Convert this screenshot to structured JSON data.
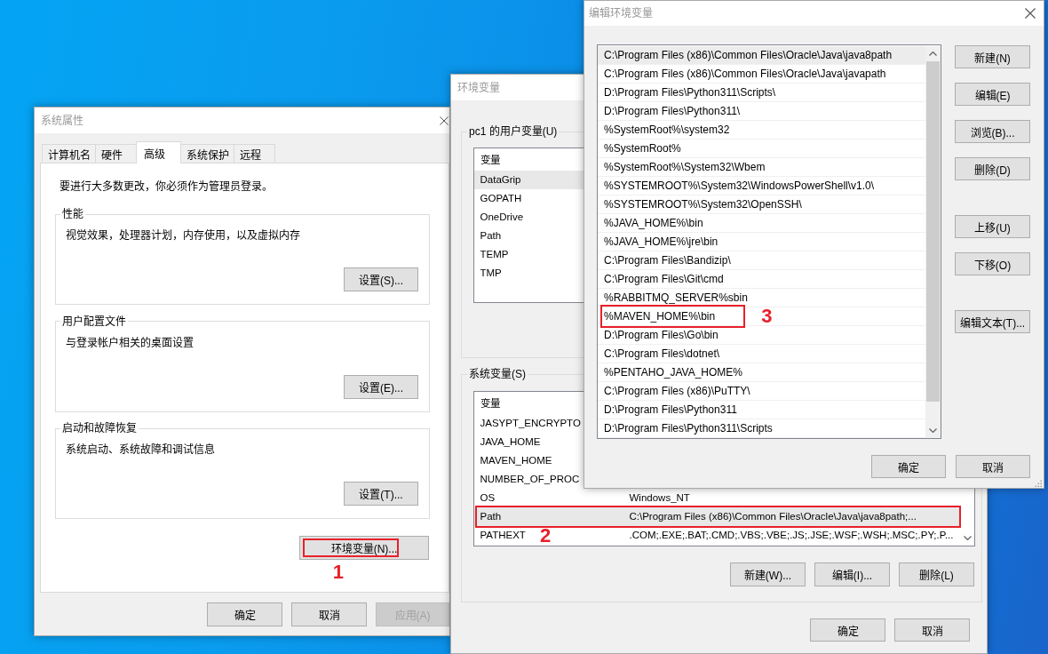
{
  "system_properties": {
    "title": "系统属性",
    "tabs": [
      {
        "label": "计算机名",
        "selected": false
      },
      {
        "label": "硬件",
        "selected": false
      },
      {
        "label": "高级",
        "selected": true
      },
      {
        "label": "系统保护",
        "selected": false
      },
      {
        "label": "远程",
        "selected": false
      }
    ],
    "notice": "要进行大多数更改，你必须作为管理员登录。",
    "groups": [
      {
        "title": "性能",
        "description": "视觉效果，处理器计划，内存使用，以及虚拟内存",
        "button": "设置(S)..."
      },
      {
        "title": "用户配置文件",
        "description": "与登录帐户相关的桌面设置",
        "button": "设置(E)..."
      },
      {
        "title": "启动和故障恢复",
        "description": "系统启动、系统故障和调试信息",
        "button": "设置(T)..."
      }
    ],
    "env_button": {
      "label": "环境变量(N)...",
      "callout": "1"
    },
    "buttons": [
      {
        "label": "确定",
        "disabled": false
      },
      {
        "label": "取消",
        "disabled": false
      },
      {
        "label": "应用(A)",
        "disabled": true
      }
    ]
  },
  "environment_variables": {
    "title": "环境变量",
    "user_variables": {
      "title": "pc1 的用户变量(U)",
      "column_header": "变量",
      "rows": [
        {
          "name": "DataGrip",
          "selected": true
        },
        {
          "name": "GOPATH",
          "selected": false
        },
        {
          "name": "OneDrive",
          "selected": false
        },
        {
          "name": "Path",
          "selected": false
        },
        {
          "name": "TEMP",
          "selected": false
        },
        {
          "name": "TMP",
          "selected": false
        }
      ]
    },
    "system_variables": {
      "title": "系统变量(S)",
      "column_header": "变量",
      "rows": [
        {
          "name": "JASYPT_ENCRYPTO",
          "selected": false
        },
        {
          "name": "JAVA_HOME",
          "selected": false
        },
        {
          "name": "MAVEN_HOME",
          "selected": false
        },
        {
          "name": "NUMBER_OF_PROC",
          "selected": false
        },
        {
          "name": "OS",
          "value": "Windows_NT",
          "selected": false
        },
        {
          "name": "Path",
          "value": "C:\\Program Files (x86)\\Common Files\\Oracle\\Java\\java8path;...",
          "selected": true,
          "callout": "2"
        },
        {
          "name": "PATHEXT",
          "value": ".COM;.EXE;.BAT;.CMD;.VBS;.VBE;.JS;.JSE;.WSF;.WSH;.MSC;.PY;.P...",
          "selected": false
        }
      ],
      "buttons": [
        "新建(W)...",
        "编辑(I)...",
        "删除(L)"
      ]
    },
    "buttons": [
      "确定",
      "取消"
    ]
  },
  "edit_variable": {
    "title": "编辑环境变量",
    "entries": [
      {
        "text": "C:\\Program Files (x86)\\Common Files\\Oracle\\Java\\java8path",
        "selected": true
      },
      {
        "text": "C:\\Program Files (x86)\\Common Files\\Oracle\\Java\\javapath",
        "selected": false
      },
      {
        "text": "D:\\Program Files\\Python311\\Scripts\\",
        "selected": false
      },
      {
        "text": "D:\\Program Files\\Python311\\",
        "selected": false
      },
      {
        "text": "%SystemRoot%\\system32",
        "selected": false
      },
      {
        "text": "%SystemRoot%",
        "selected": false
      },
      {
        "text": "%SystemRoot%\\System32\\Wbem",
        "selected": false
      },
      {
        "text": "%SYSTEMROOT%\\System32\\WindowsPowerShell\\v1.0\\",
        "selected": false
      },
      {
        "text": "%SYSTEMROOT%\\System32\\OpenSSH\\",
        "selected": false
      },
      {
        "text": "%JAVA_HOME%\\bin",
        "selected": false
      },
      {
        "text": "%JAVA_HOME%\\jre\\bin",
        "selected": false
      },
      {
        "text": "C:\\Program Files\\Bandizip\\",
        "selected": false
      },
      {
        "text": "C:\\Program Files\\Git\\cmd",
        "selected": false
      },
      {
        "text": "%RABBITMQ_SERVER%sbin",
        "selected": false
      },
      {
        "text": "%MAVEN_HOME%\\bin",
        "selected": false,
        "callout": "3"
      },
      {
        "text": "D:\\Program Files\\Go\\bin",
        "selected": false
      },
      {
        "text": "C:\\Program Files\\dotnet\\",
        "selected": false
      },
      {
        "text": "%PENTAHO_JAVA_HOME%",
        "selected": false
      },
      {
        "text": "C:\\Program Files (x86)\\PuTTY\\",
        "selected": false
      },
      {
        "text": "D:\\Program Files\\Python311",
        "selected": false
      },
      {
        "text": "D:\\Program Files\\Python311\\Scripts",
        "selected": false
      }
    ],
    "button_groups": [
      [
        "新建(N)",
        "编辑(E)",
        "浏览(B)...",
        "删除(D)"
      ],
      [
        "上移(U)",
        "下移(O)"
      ],
      [
        "编辑文本(T)..."
      ]
    ],
    "buttons": [
      "确定",
      "取消"
    ]
  }
}
